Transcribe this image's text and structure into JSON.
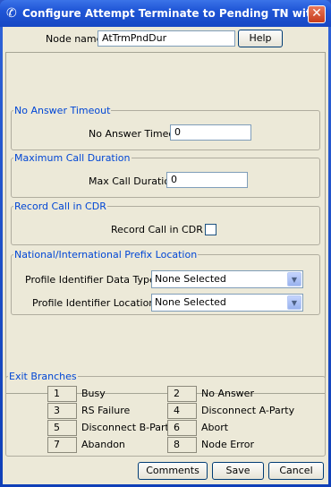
{
  "window": {
    "title": "Configure Attempt Terminate to Pending TN wit...",
    "close_glyph": "✕",
    "app_icon": "phone-handset-icon"
  },
  "header": {
    "node_name_label": "Node name",
    "node_name_value": "AtTrmPndDur",
    "help_label": "Help"
  },
  "groups": {
    "no_answer": {
      "title": "No Answer Timeout",
      "label": "No Answer Timeout",
      "value": "0"
    },
    "max_call": {
      "title": "Maximum Call Duration",
      "label": "Max Call Duration",
      "value": "0"
    },
    "record_cdr": {
      "title": "Record Call in CDR",
      "label": "Record Call in CDR",
      "checked": false
    },
    "prefix": {
      "title": "National/International Prefix Location",
      "type_label": "Profile Identifier Data Type",
      "type_value": "None Selected",
      "location_label": "Profile Identifier Location",
      "location_value": "None Selected"
    }
  },
  "exit_branches": {
    "title": "Exit Branches",
    "items": [
      {
        "num": "1",
        "label": "Busy"
      },
      {
        "num": "2",
        "label": "No Answer"
      },
      {
        "num": "3",
        "label": "RS Failure"
      },
      {
        "num": "4",
        "label": "Disconnect A-Party"
      },
      {
        "num": "5",
        "label": "Disconnect B-Party"
      },
      {
        "num": "6",
        "label": "Abort"
      },
      {
        "num": "7",
        "label": "Abandon"
      },
      {
        "num": "8",
        "label": "Node Error"
      }
    ]
  },
  "buttons": {
    "comments": "Comments",
    "save": "Save",
    "cancel": "Cancel"
  },
  "dropdown_arrow": "▼"
}
